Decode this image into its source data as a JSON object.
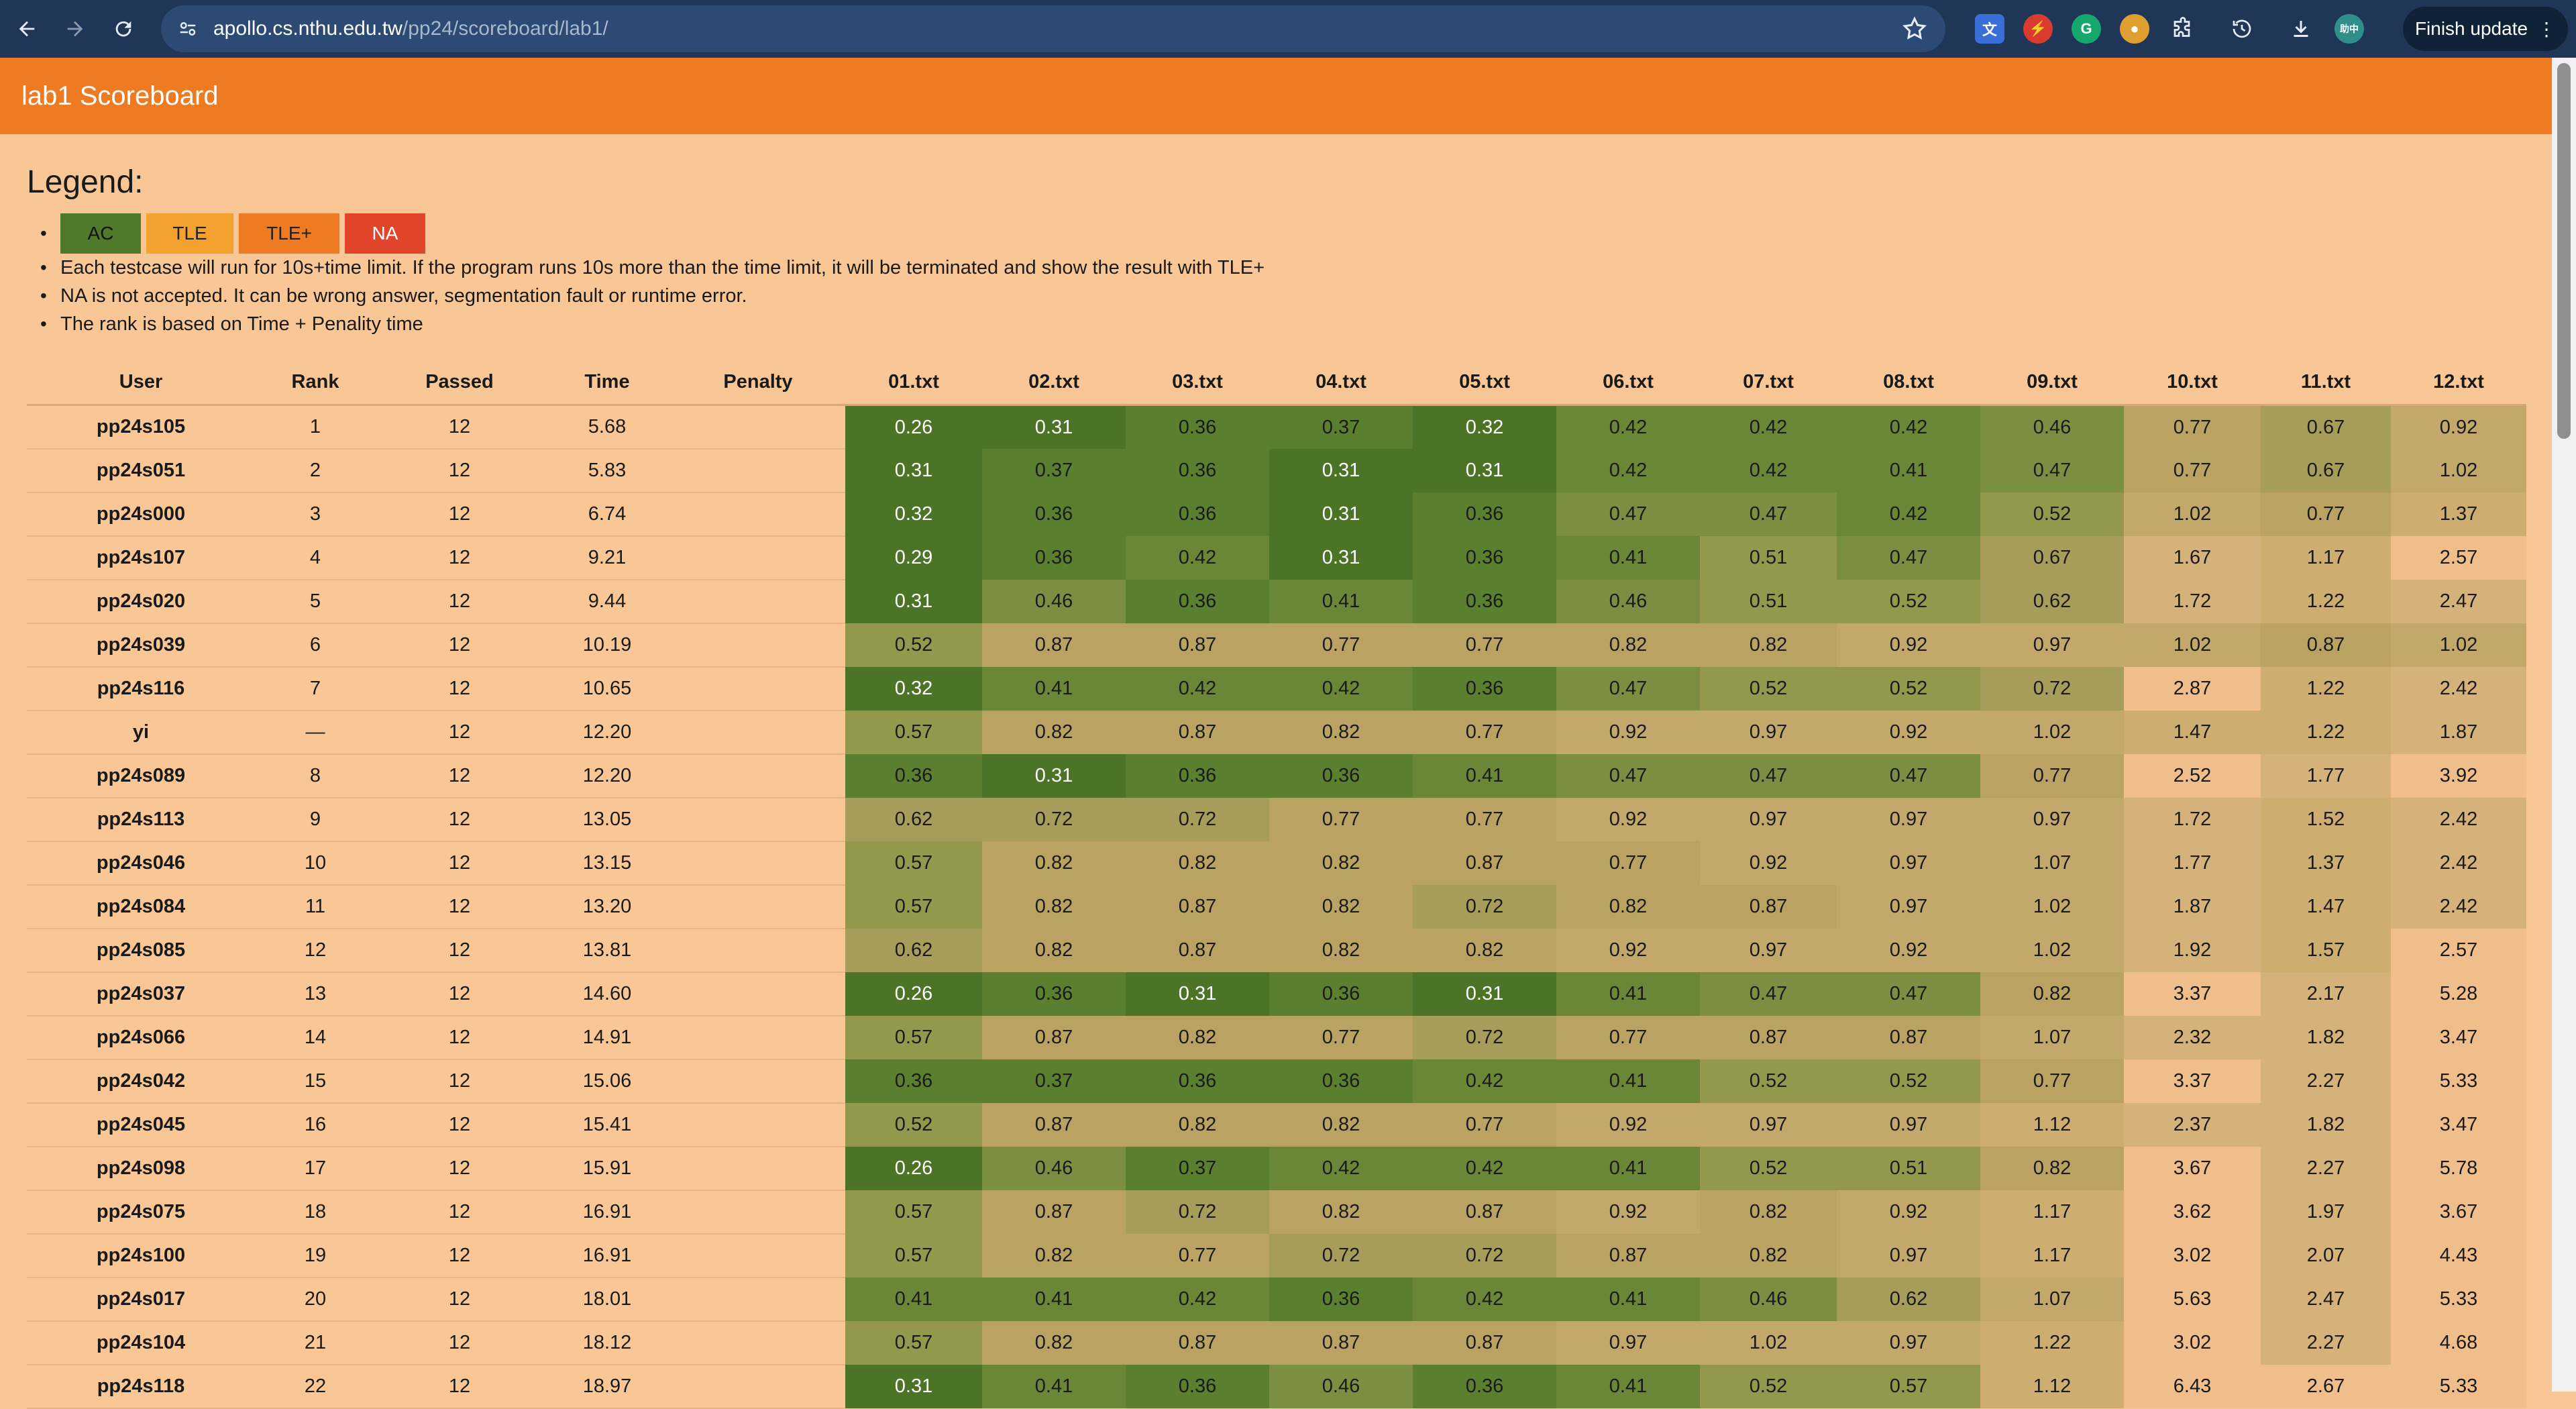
{
  "browser": {
    "url_host": "apollo.cs.nthu.edu.tw",
    "url_path": "/pp24/scoreboard/lab1/",
    "finish_update_label": "Finish update",
    "profile_label": "助中"
  },
  "page": {
    "title": "lab1 Scoreboard",
    "legend_title": "Legend:",
    "legend_badges": [
      "AC",
      "TLE",
      "TLE+",
      "NA"
    ],
    "legend_notes": [
      "Each testcase will run for 10s+time limit. If the program runs 10s more than the time limit, it will be terminated and show the result with TLE+",
      "NA is not accepted. It can be wrong answer, segmentation fault or runtime error.",
      "The rank is based on Time + Penality time"
    ]
  },
  "colors": {
    "ac": "#4e7a2a",
    "tle": "#f5a12f",
    "tle_plus": "#ee7a22",
    "na": "#e2452a",
    "header": "#ee7a22",
    "background": "#f8c795"
  },
  "scoreboard": {
    "columns": [
      "User",
      "Rank",
      "Passed",
      "Time",
      "Penalty",
      "01.txt",
      "02.txt",
      "03.txt",
      "04.txt",
      "05.txt",
      "06.txt",
      "07.txt",
      "08.txt",
      "09.txt",
      "10.txt",
      "11.txt",
      "12.txt"
    ],
    "rows": [
      {
        "user": "pp24s105",
        "rank": "1",
        "passed": "12",
        "time": "5.68",
        "penalty": "",
        "tests": [
          "0.26",
          "0.31",
          "0.36",
          "0.37",
          "0.32",
          "0.42",
          "0.42",
          "0.42",
          "0.46",
          "0.77",
          "0.67",
          "0.92"
        ]
      },
      {
        "user": "pp24s051",
        "rank": "2",
        "passed": "12",
        "time": "5.83",
        "penalty": "",
        "tests": [
          "0.31",
          "0.37",
          "0.36",
          "0.31",
          "0.31",
          "0.42",
          "0.42",
          "0.41",
          "0.47",
          "0.77",
          "0.67",
          "1.02"
        ]
      },
      {
        "user": "pp24s000",
        "rank": "3",
        "passed": "12",
        "time": "6.74",
        "penalty": "",
        "tests": [
          "0.32",
          "0.36",
          "0.36",
          "0.31",
          "0.36",
          "0.47",
          "0.47",
          "0.42",
          "0.52",
          "1.02",
          "0.77",
          "1.37"
        ]
      },
      {
        "user": "pp24s107",
        "rank": "4",
        "passed": "12",
        "time": "9.21",
        "penalty": "",
        "tests": [
          "0.29",
          "0.36",
          "0.42",
          "0.31",
          "0.36",
          "0.41",
          "0.51",
          "0.47",
          "0.67",
          "1.67",
          "1.17",
          "2.57"
        ]
      },
      {
        "user": "pp24s020",
        "rank": "5",
        "passed": "12",
        "time": "9.44",
        "penalty": "",
        "tests": [
          "0.31",
          "0.46",
          "0.36",
          "0.41",
          "0.36",
          "0.46",
          "0.51",
          "0.52",
          "0.62",
          "1.72",
          "1.22",
          "2.47"
        ]
      },
      {
        "user": "pp24s039",
        "rank": "6",
        "passed": "12",
        "time": "10.19",
        "penalty": "",
        "tests": [
          "0.52",
          "0.87",
          "0.87",
          "0.77",
          "0.77",
          "0.82",
          "0.82",
          "0.92",
          "0.97",
          "1.02",
          "0.87",
          "1.02"
        ]
      },
      {
        "user": "pp24s116",
        "rank": "7",
        "passed": "12",
        "time": "10.65",
        "penalty": "",
        "tests": [
          "0.32",
          "0.41",
          "0.42",
          "0.42",
          "0.36",
          "0.47",
          "0.52",
          "0.52",
          "0.72",
          "2.87",
          "1.22",
          "2.42"
        ]
      },
      {
        "user": "yi",
        "rank": "—",
        "passed": "12",
        "time": "12.20",
        "penalty": "",
        "tests": [
          "0.57",
          "0.82",
          "0.87",
          "0.82",
          "0.77",
          "0.92",
          "0.97",
          "0.92",
          "1.02",
          "1.47",
          "1.22",
          "1.87"
        ]
      },
      {
        "user": "pp24s089",
        "rank": "8",
        "passed": "12",
        "time": "12.20",
        "penalty": "",
        "tests": [
          "0.36",
          "0.31",
          "0.36",
          "0.36",
          "0.41",
          "0.47",
          "0.47",
          "0.47",
          "0.77",
          "2.52",
          "1.77",
          "3.92"
        ]
      },
      {
        "user": "pp24s113",
        "rank": "9",
        "passed": "12",
        "time": "13.05",
        "penalty": "",
        "tests": [
          "0.62",
          "0.72",
          "0.72",
          "0.77",
          "0.77",
          "0.92",
          "0.97",
          "0.97",
          "0.97",
          "1.72",
          "1.52",
          "2.42"
        ]
      },
      {
        "user": "pp24s046",
        "rank": "10",
        "passed": "12",
        "time": "13.15",
        "penalty": "",
        "tests": [
          "0.57",
          "0.82",
          "0.82",
          "0.82",
          "0.87",
          "0.77",
          "0.92",
          "0.97",
          "1.07",
          "1.77",
          "1.37",
          "2.42"
        ]
      },
      {
        "user": "pp24s084",
        "rank": "11",
        "passed": "12",
        "time": "13.20",
        "penalty": "",
        "tests": [
          "0.57",
          "0.82",
          "0.87",
          "0.82",
          "0.72",
          "0.82",
          "0.87",
          "0.97",
          "1.02",
          "1.87",
          "1.47",
          "2.42"
        ]
      },
      {
        "user": "pp24s085",
        "rank": "12",
        "passed": "12",
        "time": "13.81",
        "penalty": "",
        "tests": [
          "0.62",
          "0.82",
          "0.87",
          "0.82",
          "0.82",
          "0.92",
          "0.97",
          "0.92",
          "1.02",
          "1.92",
          "1.57",
          "2.57"
        ]
      },
      {
        "user": "pp24s037",
        "rank": "13",
        "passed": "12",
        "time": "14.60",
        "penalty": "",
        "tests": [
          "0.26",
          "0.36",
          "0.31",
          "0.36",
          "0.31",
          "0.41",
          "0.47",
          "0.47",
          "0.82",
          "3.37",
          "2.17",
          "5.28"
        ]
      },
      {
        "user": "pp24s066",
        "rank": "14",
        "passed": "12",
        "time": "14.91",
        "penalty": "",
        "tests": [
          "0.57",
          "0.87",
          "0.82",
          "0.77",
          "0.72",
          "0.77",
          "0.87",
          "0.87",
          "1.07",
          "2.32",
          "1.82",
          "3.47"
        ]
      },
      {
        "user": "pp24s042",
        "rank": "15",
        "passed": "12",
        "time": "15.06",
        "penalty": "",
        "tests": [
          "0.36",
          "0.37",
          "0.36",
          "0.36",
          "0.42",
          "0.41",
          "0.52",
          "0.52",
          "0.77",
          "3.37",
          "2.27",
          "5.33"
        ]
      },
      {
        "user": "pp24s045",
        "rank": "16",
        "passed": "12",
        "time": "15.41",
        "penalty": "",
        "tests": [
          "0.52",
          "0.87",
          "0.82",
          "0.82",
          "0.77",
          "0.92",
          "0.97",
          "0.97",
          "1.12",
          "2.37",
          "1.82",
          "3.47"
        ]
      },
      {
        "user": "pp24s098",
        "rank": "17",
        "passed": "12",
        "time": "15.91",
        "penalty": "",
        "tests": [
          "0.26",
          "0.46",
          "0.37",
          "0.42",
          "0.42",
          "0.41",
          "0.52",
          "0.51",
          "0.82",
          "3.67",
          "2.27",
          "5.78"
        ]
      },
      {
        "user": "pp24s075",
        "rank": "18",
        "passed": "12",
        "time": "16.91",
        "penalty": "",
        "tests": [
          "0.57",
          "0.87",
          "0.72",
          "0.82",
          "0.87",
          "0.92",
          "0.82",
          "0.92",
          "1.17",
          "3.62",
          "1.97",
          "3.67"
        ]
      },
      {
        "user": "pp24s100",
        "rank": "19",
        "passed": "12",
        "time": "16.91",
        "penalty": "",
        "tests": [
          "0.57",
          "0.82",
          "0.77",
          "0.72",
          "0.72",
          "0.87",
          "0.82",
          "0.97",
          "1.17",
          "3.02",
          "2.07",
          "4.43"
        ]
      },
      {
        "user": "pp24s017",
        "rank": "20",
        "passed": "12",
        "time": "18.01",
        "penalty": "",
        "tests": [
          "0.41",
          "0.41",
          "0.42",
          "0.36",
          "0.42",
          "0.41",
          "0.46",
          "0.62",
          "1.07",
          "5.63",
          "2.47",
          "5.33"
        ]
      },
      {
        "user": "pp24s104",
        "rank": "21",
        "passed": "12",
        "time": "18.12",
        "penalty": "",
        "tests": [
          "0.57",
          "0.82",
          "0.87",
          "0.87",
          "0.87",
          "0.97",
          "1.02",
          "0.97",
          "1.22",
          "3.02",
          "2.27",
          "4.68"
        ]
      },
      {
        "user": "pp24s118",
        "rank": "22",
        "passed": "12",
        "time": "18.97",
        "penalty": "",
        "tests": [
          "0.31",
          "0.41",
          "0.36",
          "0.46",
          "0.36",
          "0.41",
          "0.52",
          "0.57",
          "1.12",
          "6.43",
          "2.67",
          "5.33"
        ]
      }
    ]
  }
}
